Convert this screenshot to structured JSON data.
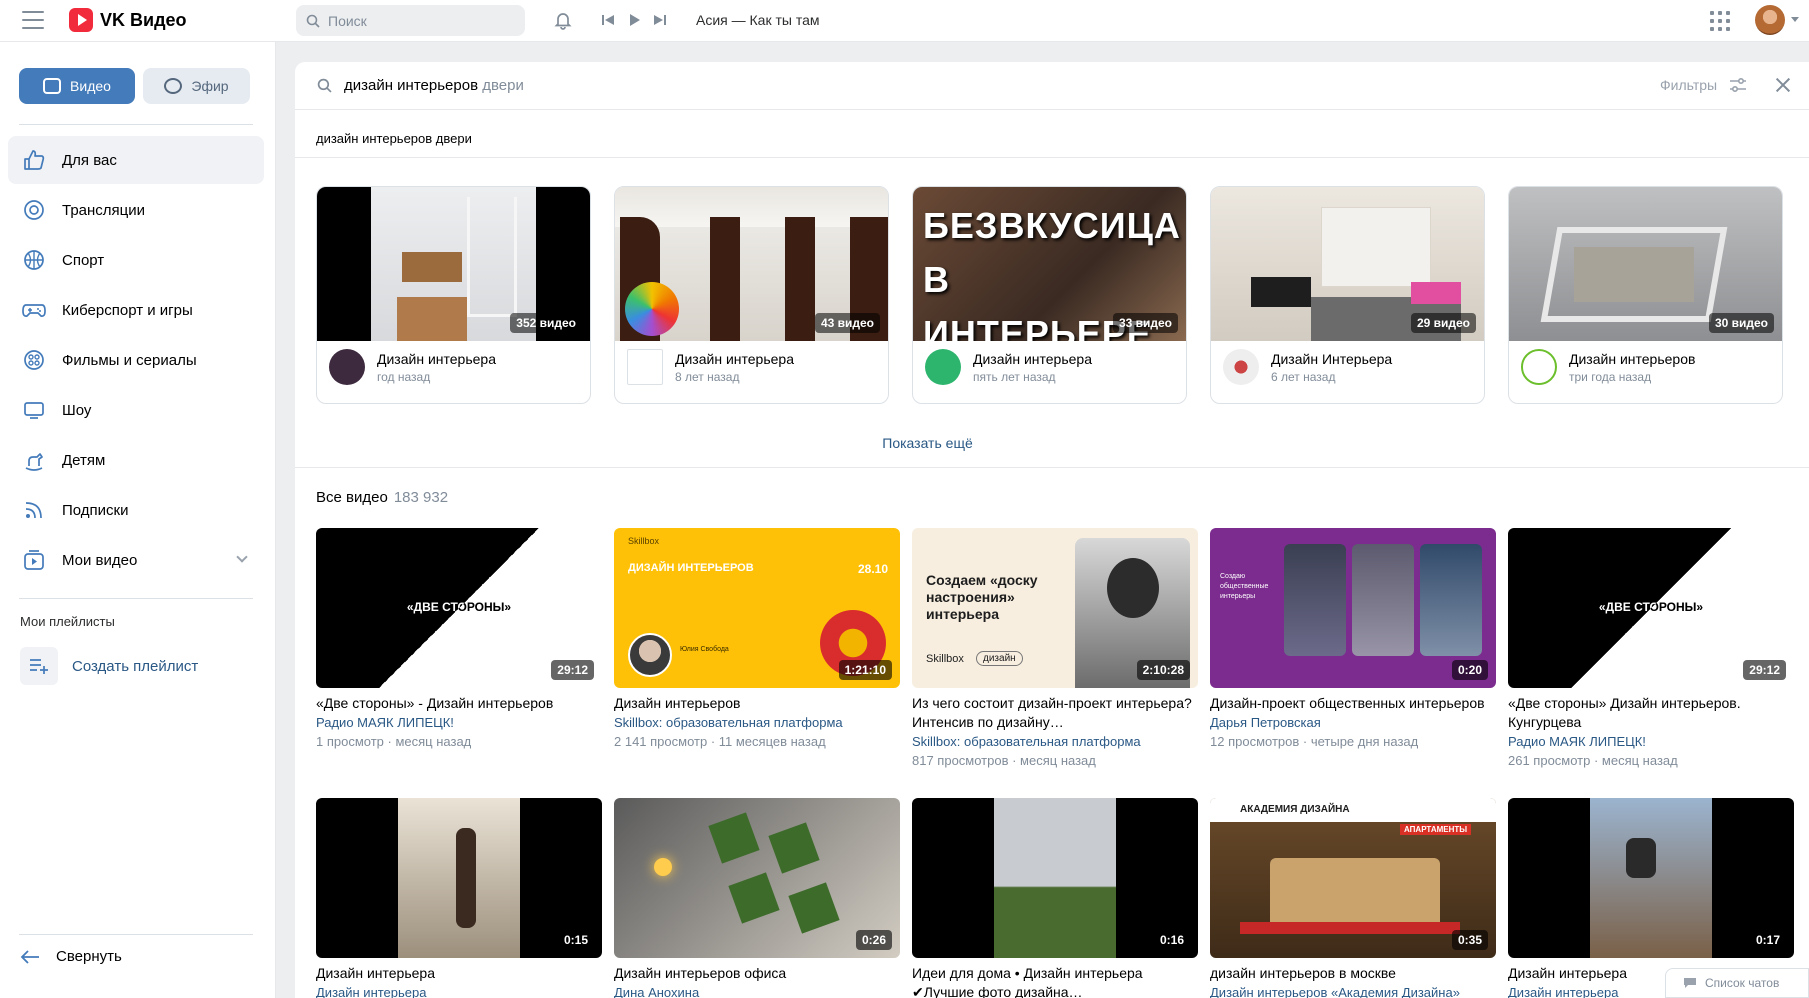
{
  "app": {
    "title": "VK Видео"
  },
  "topbar": {
    "search_placeholder": "Поиск",
    "now_playing": "Асия — Как ты там"
  },
  "sidebar": {
    "segments": [
      {
        "label": "Видео",
        "active": true
      },
      {
        "label": "Эфир",
        "active": false
      }
    ],
    "items": [
      {
        "label": "Для вас",
        "icon": "thumbs-up-icon",
        "active": true
      },
      {
        "label": "Трансляции",
        "icon": "broadcast-icon"
      },
      {
        "label": "Спорт",
        "icon": "ball-icon"
      },
      {
        "label": "Киберспорт и игры",
        "icon": "gamepad-icon"
      },
      {
        "label": "Фильмы и сериалы",
        "icon": "film-reel-icon"
      },
      {
        "label": "Шоу",
        "icon": "tv-icon"
      },
      {
        "label": "Детям",
        "icon": "rocking-horse-icon"
      },
      {
        "label": "Подписки",
        "icon": "feed-icon"
      },
      {
        "label": "Мои видео",
        "icon": "my-video-icon",
        "expandable": true
      }
    ],
    "playlists_title": "Мои плейлисты",
    "create_playlist": "Создать плейлист",
    "collapse": "Свернуть"
  },
  "search": {
    "query": "дизайн интерьеров",
    "completion": " двери",
    "filters_label": "Фильтры",
    "suggestion": "дизайн интерьеров двери"
  },
  "playlists": [
    {
      "title": "Дизайн интерьера",
      "time": "год назад",
      "count": "352 видео"
    },
    {
      "title": "Дизайн интерьера",
      "time": "8 лет назад",
      "count": "43 видео"
    },
    {
      "title": "Дизайн интерьера",
      "time": "пять лет назад",
      "count": "33 видео",
      "overlay": "БЕЗВКУСИЦА В ИНТЕРЬЕРЕ"
    },
    {
      "title": "Дизайн Интерьера",
      "time": "6 лет назад",
      "count": "29 видео"
    },
    {
      "title": "Дизайн интерьеров",
      "time": "три года назад",
      "count": "30 видео"
    }
  ],
  "show_more": "Показать ещё",
  "all_videos": {
    "title": "Все видео",
    "count": "183 932"
  },
  "videos": [
    {
      "title": "«Две стороны» - Дизайн интерьеров",
      "author": "Радио МАЯК ЛИПЕЦК!",
      "stats": "1 просмотр · месяц назад",
      "duration": "29:12",
      "thumb_text": "«ДВЕ СТОРОНЫ»"
    },
    {
      "title": "Дизайн интерьеров",
      "author": "Skillbox: образовательная платформа",
      "stats": "2 141 просмотр · 11 месяцев назад",
      "duration": "1:21:10",
      "thumb_text": "ДИЗАЙН ИНТЕРЬЕРОВ",
      "thumb_brand": "Skillbox",
      "thumb_date": "28.10",
      "thumb_person": "Юлия Свобода"
    },
    {
      "title": "Из чего состоит дизайн-проект интерьера? Интенсив по дизайну…",
      "author": "Skillbox: образовательная платформа",
      "stats": "817 просмотров · месяц назад",
      "duration": "2:10:28",
      "thumb_text": "Создаем «доску настроения» интерьера",
      "thumb_brand": "Skillbox",
      "thumb_tag": "дизайн"
    },
    {
      "title": "Дизайн-проект общественных интерьеров",
      "author": "Дарья Петровская",
      "stats": "12 просмотров · четыре дня назад",
      "duration": "0:20",
      "thumb_text": "Создаю общественные интерьеры"
    },
    {
      "title": "«Две стороны» Дизайн интерьеров. Кунгурцева",
      "author": "Радио МАЯК ЛИПЕЦК!",
      "stats": "261 просмотр · месяц назад",
      "duration": "29:12",
      "thumb_text": "«ДВЕ СТОРОНЫ»"
    },
    {
      "title": "Дизайн интерьера",
      "author": "Дизайн интерьера",
      "stats": "",
      "duration": "0:15"
    },
    {
      "title": "Дизайн интерьеров офиса",
      "author": "Дина Анохина",
      "stats": "",
      "duration": "0:26"
    },
    {
      "title": "Идеи для дома • Дизайн интерьера ✔Лучшие фото дизайна…",
      "author": "",
      "stats": "",
      "duration": "0:16"
    },
    {
      "title": "дизайн интерьеров в москве",
      "author": "Дизайн интерьеров «Академия Дизайна»",
      "stats": "",
      "duration": "0:35",
      "thumb_text": "АКАДЕМИЯ ДИЗАЙНА",
      "thumb_sub": "АПАРТАМЕНТЫ"
    },
    {
      "title": "Дизайн интерьера",
      "author": "Дизайн интерьера",
      "stats": "",
      "duration": "0:17"
    }
  ],
  "chat": {
    "label": "Список чатов"
  },
  "colors": {
    "accent": "#447bba",
    "link": "#2a5885",
    "muted": "#818c99",
    "brand_red": "#f22b3c"
  }
}
